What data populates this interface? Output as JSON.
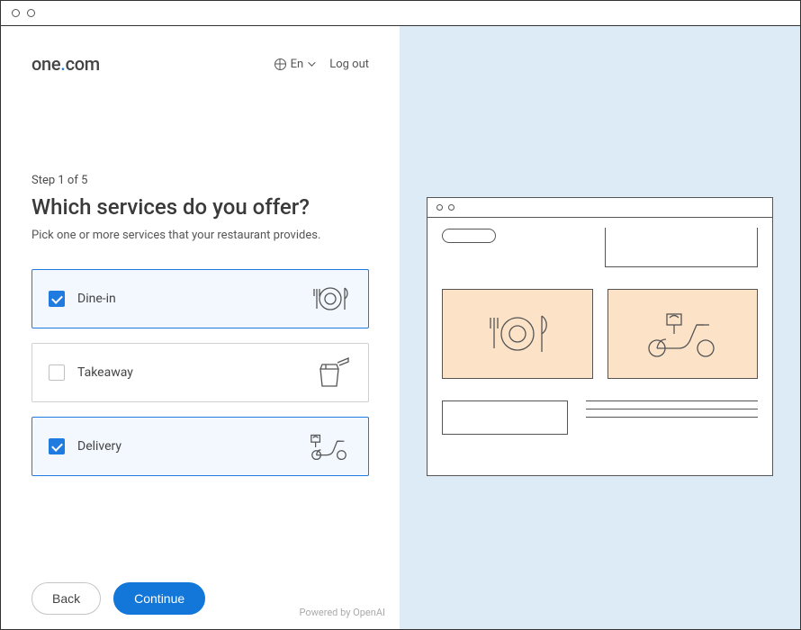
{
  "header": {
    "brand_prefix": "one",
    "brand_dot": ".",
    "brand_suffix": "com",
    "language_label": "En",
    "logout_label": "Log out"
  },
  "wizard": {
    "step_label": "Step 1 of 5",
    "title": "Which services do you offer?",
    "subtitle": "Pick one or more services that your restaurant provides."
  },
  "options": [
    {
      "id": "dine-in",
      "label": "Dine-in",
      "checked": true,
      "icon": "plate-icon"
    },
    {
      "id": "takeaway",
      "label": "Takeaway",
      "checked": false,
      "icon": "bag-icon"
    },
    {
      "id": "delivery",
      "label": "Delivery",
      "checked": true,
      "icon": "scooter-icon"
    }
  ],
  "footer": {
    "back_label": "Back",
    "continue_label": "Continue",
    "powered_by": "Powered by OpenAI"
  }
}
